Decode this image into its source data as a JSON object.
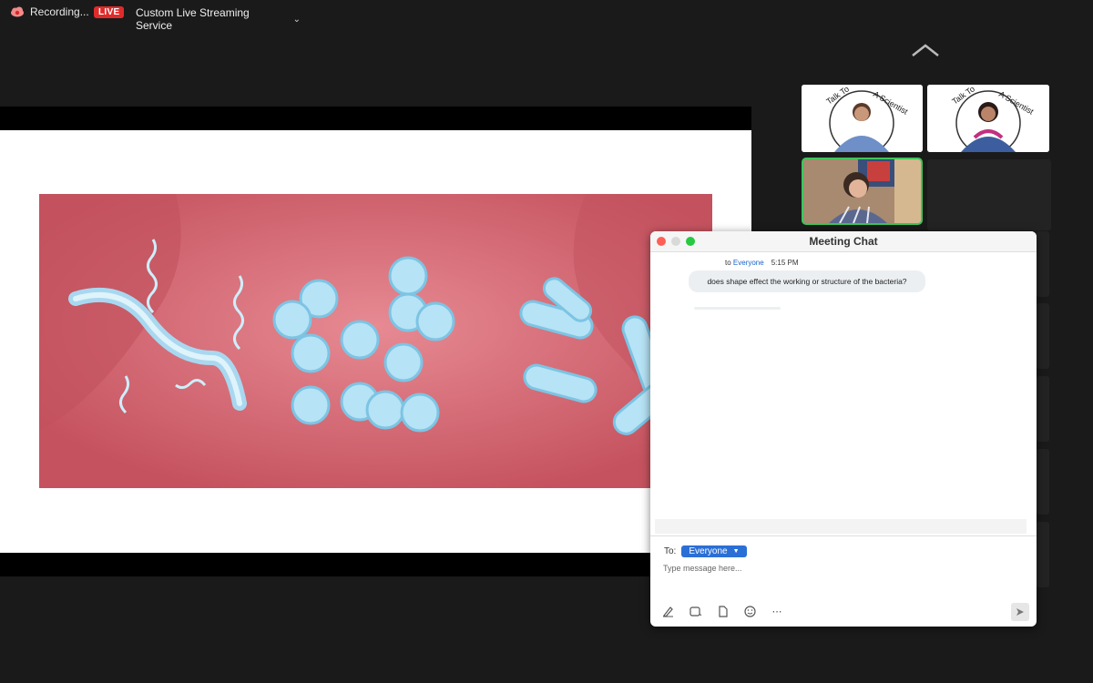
{
  "topbar": {
    "recording_label": "Recording...",
    "live_label": "LIVE",
    "stream_label": "Custom Live Streaming Service"
  },
  "thumbnails": {
    "logo_text": "Talk To A Scientist"
  },
  "chat": {
    "title": "Meeting Chat",
    "message": {
      "to_prefix": "to",
      "to_name": "Everyone",
      "time": "5:15 PM",
      "text": "does shape effect the working  or structure of the bacteria?"
    },
    "to_label": "To:",
    "recipient": "Everyone",
    "input_placeholder": "Type message here..."
  },
  "colors": {
    "live_red": "#e02b2b",
    "active_speaker_green": "#3ec55a",
    "chat_accent_blue": "#2a6fd6",
    "slide_pink": "#d4626e"
  }
}
